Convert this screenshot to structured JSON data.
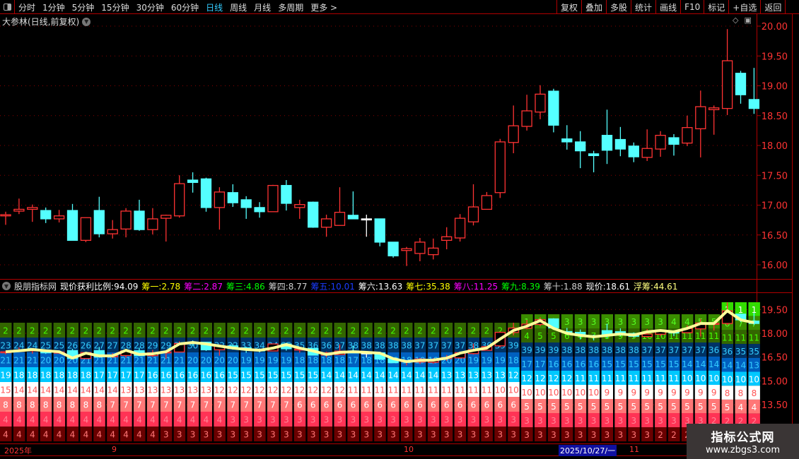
{
  "toolbar": {
    "periods": [
      "分时",
      "1分钟",
      "5分钟",
      "15分钟",
      "30分钟",
      "60分钟",
      "日线",
      "周线",
      "月线",
      "多周期",
      "更多 >"
    ],
    "active_period": "日线",
    "buttons": [
      "复权",
      "叠加",
      "多股",
      "统计",
      "画线",
      "F10",
      "标记",
      "+自选",
      "返回"
    ]
  },
  "main": {
    "title": "大参林(日线,前复权)",
    "icons": [
      "chevron-down-icon",
      "diamond-icon",
      "panel-toggle-icon"
    ]
  },
  "indicator": {
    "name": "股朋指标网",
    "legend": [
      {
        "label": "现价获利比例:",
        "value": "94.09",
        "color": "#ffffff"
      },
      {
        "label": "筹一:",
        "value": "2.78",
        "color": "#ffff00"
      },
      {
        "label": "筹二:",
        "value": "2.87",
        "color": "#ff00ff"
      },
      {
        "label": "筹三:",
        "value": "4.86",
        "color": "#00ff00"
      },
      {
        "label": "筹四:",
        "value": "8.77",
        "color": "#d0d0d0"
      },
      {
        "label": "筹五:",
        "value": "10.01",
        "color": "#1a3cff"
      },
      {
        "label": "筹六:",
        "value": "13.63",
        "color": "#ffffff"
      },
      {
        "label": "筹七:",
        "value": "35.38",
        "color": "#ffff00"
      },
      {
        "label": "筹八:",
        "value": "11.25",
        "color": "#ff00ff"
      },
      {
        "label": "筹九:",
        "value": "8.39",
        "color": "#00ff00"
      },
      {
        "label": "筹十:",
        "value": "1.88",
        "color": "#d0d0d0"
      },
      {
        "label": "现价:",
        "value": "18.61",
        "color": "#ffffff"
      },
      {
        "label": "浮筹:",
        "value": "44.61",
        "color": "#ffff80"
      }
    ]
  },
  "dates": {
    "year": "2025年",
    "m9": "9",
    "m10": "10",
    "cursor": "2025/10/27/一",
    "m11": "11"
  },
  "watermark": {
    "line1": "指标公式网",
    "line2": "www.zbgs3.com"
  },
  "colors": {
    "up": "#ff3333",
    "down": "#54ffff",
    "avg_line": "#ffff99",
    "axis": "#b00000",
    "tick_text": "#ff3333"
  },
  "chart_data": {
    "type": "candlestick",
    "price_axis": {
      "ticks": [
        "20.00",
        "19.50",
        "19.00",
        "18.50",
        "18.00",
        "17.50",
        "17.00",
        "16.50",
        "16.00"
      ],
      "range": [
        15.8,
        20.05
      ]
    },
    "indicator_axis": {
      "ticks": [
        "19.50",
        "18.00",
        "16.50",
        "15.00",
        "13.50"
      ]
    },
    "candles": [
      [
        16.82,
        16.89,
        16.67,
        16.84
      ],
      [
        16.9,
        17.11,
        16.85,
        16.93
      ],
      [
        16.93,
        17.01,
        16.72,
        16.96
      ],
      [
        16.91,
        16.96,
        16.7,
        16.77
      ],
      [
        16.77,
        16.92,
        16.71,
        16.82
      ],
      [
        16.91,
        17.02,
        16.41,
        16.41
      ],
      [
        16.41,
        16.79,
        16.38,
        16.79
      ],
      [
        16.91,
        17.14,
        16.46,
        16.52
      ],
      [
        16.52,
        16.75,
        16.44,
        16.59
      ],
      [
        16.6,
        16.95,
        16.46,
        16.9
      ],
      [
        16.9,
        17.09,
        16.57,
        16.59
      ],
      [
        16.59,
        16.95,
        16.51,
        16.77
      ],
      [
        16.78,
        16.84,
        16.39,
        16.83
      ],
      [
        16.82,
        17.5,
        16.79,
        17.36
      ],
      [
        17.42,
        17.55,
        17.21,
        17.38
      ],
      [
        17.44,
        17.46,
        16.89,
        16.96
      ],
      [
        16.96,
        17.3,
        16.59,
        17.22
      ],
      [
        17.21,
        17.35,
        16.97,
        17.04
      ],
      [
        17.09,
        17.15,
        16.77,
        16.96
      ],
      [
        16.96,
        17.05,
        16.79,
        16.89
      ],
      [
        16.89,
        17.34,
        16.89,
        17.33
      ],
      [
        17.33,
        17.42,
        16.91,
        17.03
      ],
      [
        16.96,
        17.09,
        16.77,
        17.01
      ],
      [
        17.05,
        17.06,
        16.62,
        16.63
      ],
      [
        16.63,
        16.84,
        16.47,
        16.77
      ],
      [
        16.66,
        17.3,
        16.66,
        16.88
      ],
      [
        16.83,
        17.23,
        16.77,
        16.77
      ],
      [
        16.77,
        16.84,
        16.47,
        16.77
      ],
      [
        16.77,
        16.77,
        16.31,
        16.38
      ],
      [
        16.38,
        16.38,
        16.12,
        16.15
      ],
      [
        16.24,
        16.3,
        15.98,
        16.27
      ],
      [
        16.19,
        16.45,
        16.06,
        16.38
      ],
      [
        16.17,
        16.44,
        16.09,
        16.28
      ],
      [
        16.41,
        16.63,
        16.26,
        16.47
      ],
      [
        16.45,
        16.85,
        16.39,
        16.78
      ],
      [
        16.72,
        17.35,
        16.66,
        16.97
      ],
      [
        16.93,
        17.22,
        16.93,
        17.16
      ],
      [
        17.21,
        18.11,
        17.12,
        18.06
      ],
      [
        18.05,
        18.67,
        17.87,
        18.33
      ],
      [
        18.32,
        18.85,
        18.25,
        18.58
      ],
      [
        18.56,
        19.01,
        18.44,
        18.86
      ],
      [
        18.91,
        18.95,
        18.22,
        18.34
      ],
      [
        18.11,
        18.34,
        17.93,
        18.06
      ],
      [
        18.06,
        18.24,
        17.62,
        17.91
      ],
      [
        17.86,
        17.91,
        17.55,
        17.83
      ],
      [
        18.17,
        18.6,
        17.69,
        17.92
      ],
      [
        18.1,
        18.31,
        17.82,
        17.94
      ],
      [
        17.99,
        18.05,
        17.72,
        17.81
      ],
      [
        17.8,
        18.27,
        17.74,
        17.95
      ],
      [
        17.94,
        18.24,
        17.81,
        18.17
      ],
      [
        18.13,
        18.19,
        17.83,
        18.02
      ],
      [
        18.04,
        18.5,
        17.99,
        18.3
      ],
      [
        18.28,
        18.92,
        17.8,
        18.65
      ],
      [
        18.6,
        18.67,
        18.18,
        18.63
      ],
      [
        18.62,
        19.95,
        18.51,
        19.42
      ],
      [
        19.21,
        19.25,
        18.7,
        18.85
      ],
      [
        18.77,
        19.3,
        18.53,
        18.62
      ]
    ],
    "avg_cost_line": [
      16.84,
      16.9,
      16.98,
      16.9,
      16.84,
      16.44,
      16.75,
      16.58,
      16.58,
      16.93,
      16.67,
      16.71,
      16.84,
      17.33,
      17.42,
      17.33,
      17.2,
      17.07,
      16.98,
      16.93,
      17.07,
      17.29,
      17.07,
      16.89,
      16.67,
      16.8,
      16.84,
      16.8,
      16.75,
      16.4,
      16.22,
      16.3,
      16.31,
      16.44,
      16.75,
      16.93,
      17.07,
      17.64,
      18.18,
      18.45,
      18.8,
      18.31,
      18.0,
      17.87,
      17.78,
      17.87,
      17.96,
      17.89,
      18.09,
      18.18,
      18.09,
      18.31,
      18.62,
      18.62,
      19.42,
      18.85,
      18.67
    ],
    "chip_columns": [
      [
        2,
        23,
        21,
        19,
        15,
        8,
        4,
        4
      ],
      [
        2,
        24,
        21,
        18,
        14,
        8,
        4,
        4
      ],
      [
        2,
        24,
        21,
        18,
        14,
        8,
        4,
        4
      ],
      [
        2,
        25,
        20,
        18,
        14,
        8,
        4,
        4
      ],
      [
        2,
        25,
        20,
        18,
        14,
        8,
        4,
        4
      ],
      [
        2,
        26,
        20,
        18,
        14,
        8,
        4,
        4
      ],
      [
        2,
        26,
        21,
        18,
        14,
        8,
        4,
        4
      ],
      [
        2,
        27,
        21,
        17,
        14,
        8,
        4,
        4
      ],
      [
        2,
        27,
        21,
        17,
        14,
        7,
        4,
        4
      ],
      [
        2,
        28,
        21,
        17,
        13,
        7,
        4,
        4
      ],
      [
        2,
        28,
        21,
        17,
        13,
        7,
        4,
        4
      ],
      [
        2,
        29,
        21,
        16,
        13,
        7,
        4,
        4
      ],
      [
        2,
        29,
        21,
        16,
        13,
        7,
        4,
        3
      ],
      [
        2,
        30,
        21,
        16,
        13,
        7,
        4,
        3
      ],
      [
        2,
        30,
        20,
        16,
        13,
        7,
        4,
        3
      ],
      [
        2,
        31,
        20,
        16,
        13,
        7,
        4,
        3
      ],
      [
        2,
        32,
        20,
        16,
        12,
        7,
        4,
        3
      ],
      [
        2,
        32,
        20,
        15,
        12,
        7,
        3,
        3
      ],
      [
        2,
        33,
        19,
        15,
        12,
        7,
        3,
        3
      ],
      [
        2,
        34,
        19,
        15,
        12,
        7,
        3,
        3
      ],
      [
        2,
        34,
        19,
        15,
        12,
        7,
        3,
        3
      ],
      [
        2,
        35,
        19,
        15,
        12,
        7,
        3,
        3
      ],
      [
        2,
        35,
        18,
        15,
        12,
        6,
        3,
        3
      ],
      [
        2,
        36,
        18,
        15,
        12,
        6,
        3,
        3
      ],
      [
        2,
        36,
        18,
        14,
        12,
        6,
        3,
        3
      ],
      [
        2,
        37,
        18,
        14,
        12,
        6,
        3,
        3
      ],
      [
        2,
        38,
        17,
        14,
        11,
        6,
        3,
        3
      ],
      [
        2,
        38,
        18,
        14,
        11,
        6,
        3,
        3
      ],
      [
        2,
        38,
        18,
        14,
        11,
        6,
        3,
        3
      ],
      [
        2,
        38,
        18,
        14,
        11,
        6,
        3,
        3
      ],
      [
        2,
        38,
        18,
        14,
        11,
        6,
        3,
        3
      ],
      [
        2,
        37,
        19,
        14,
        11,
        6,
        3,
        3
      ],
      [
        2,
        37,
        19,
        14,
        11,
        6,
        3,
        3
      ],
      [
        2,
        37,
        20,
        13,
        11,
        6,
        3,
        3
      ],
      [
        2,
        37,
        20,
        13,
        11,
        6,
        3,
        3
      ],
      [
        2,
        38,
        19,
        13,
        11,
        6,
        3,
        3
      ],
      [
        2,
        39,
        19,
        13,
        11,
        6,
        3,
        3
      ],
      [
        2,
        39,
        19,
        13,
        10,
        6,
        3,
        3
      ],
      [
        5,
        39,
        18,
        12,
        10,
        6,
        3,
        3
      ],
      [
        1,
        4,
        39,
        17,
        12,
        10,
        5,
        3,
        3
      ],
      [
        2,
        5,
        39,
        17,
        12,
        10,
        5,
        3,
        3
      ],
      [
        2,
        5,
        39,
        16,
        12,
        10,
        5,
        3,
        3
      ],
      [
        3,
        6,
        38,
        16,
        12,
        10,
        5,
        3,
        3
      ],
      [
        3,
        4,
        38,
        16,
        11,
        10,
        5,
        3,
        3
      ],
      [
        3,
        7,
        38,
        16,
        11,
        10,
        5,
        3,
        3
      ],
      [
        3,
        8,
        38,
        15,
        11,
        9,
        5,
        3,
        3
      ],
      [
        3,
        9,
        38,
        15,
        11,
        9,
        5,
        3,
        3
      ],
      [
        3,
        9,
        38,
        15,
        11,
        9,
        5,
        3,
        3
      ],
      [
        3,
        10,
        37,
        15,
        11,
        9,
        5,
        3,
        3
      ],
      [
        3,
        10,
        37,
        15,
        11,
        9,
        5,
        3,
        2
      ],
      [
        4,
        11,
        37,
        15,
        11,
        9,
        5,
        3,
        2
      ],
      [
        4,
        11,
        37,
        14,
        10,
        9,
        5,
        3,
        2
      ],
      [
        5,
        11,
        37,
        14,
        10,
        9,
        5,
        3,
        2
      ],
      [
        5,
        11,
        36,
        14,
        10,
        9,
        5,
        2,
        2
      ],
      [
        1,
        6,
        11,
        36,
        14,
        10,
        8,
        5,
        2,
        2
      ],
      [
        1,
        7,
        11,
        35,
        14,
        10,
        8,
        4,
        2,
        2
      ],
      [
        1,
        7,
        11,
        35,
        13,
        10,
        8,
        4,
        2,
        2
      ]
    ]
  }
}
